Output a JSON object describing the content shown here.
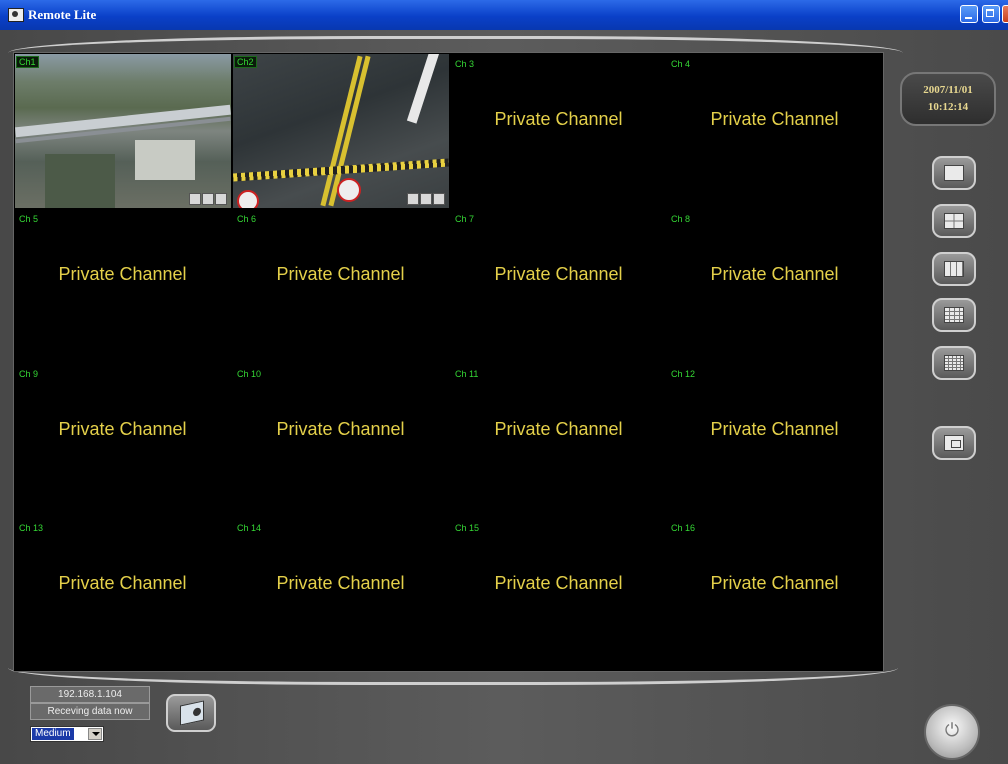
{
  "window": {
    "title": "Remote Lite"
  },
  "clock": {
    "date": "2007/11/01",
    "time": "10:12:14"
  },
  "channels": [
    {
      "label": "Ch1",
      "text": ""
    },
    {
      "label": "Ch2",
      "text": ""
    },
    {
      "label": "Ch 3",
      "text": "Private Channel"
    },
    {
      "label": "Ch 4",
      "text": "Private Channel"
    },
    {
      "label": "Ch 5",
      "text": "Private Channel"
    },
    {
      "label": "Ch 6",
      "text": "Private Channel"
    },
    {
      "label": "Ch 7",
      "text": "Private Channel"
    },
    {
      "label": "Ch 8",
      "text": "Private Channel"
    },
    {
      "label": "Ch 9",
      "text": "Private Channel"
    },
    {
      "label": "Ch 10",
      "text": "Private Channel"
    },
    {
      "label": "Ch 11",
      "text": "Private Channel"
    },
    {
      "label": "Ch 12",
      "text": "Private Channel"
    },
    {
      "label": "Ch 13",
      "text": "Private Channel"
    },
    {
      "label": "Ch 14",
      "text": "Private Channel"
    },
    {
      "label": "Ch 15",
      "text": "Private Channel"
    },
    {
      "label": "Ch 16",
      "text": "Private Channel"
    }
  ],
  "layout_buttons": [
    "single-view",
    "quad-view",
    "nine-view",
    "sixteen-view",
    "twenty-five-view",
    "fullscreen-view"
  ],
  "status": {
    "ip": "192.168.1.104",
    "message": "Receving data now",
    "quality": "Medium"
  },
  "colors": {
    "channel_label": "#35d835",
    "private_text": "#e4d04a",
    "clock_text": "#e8d890",
    "titlebar": "#0a40c8"
  }
}
